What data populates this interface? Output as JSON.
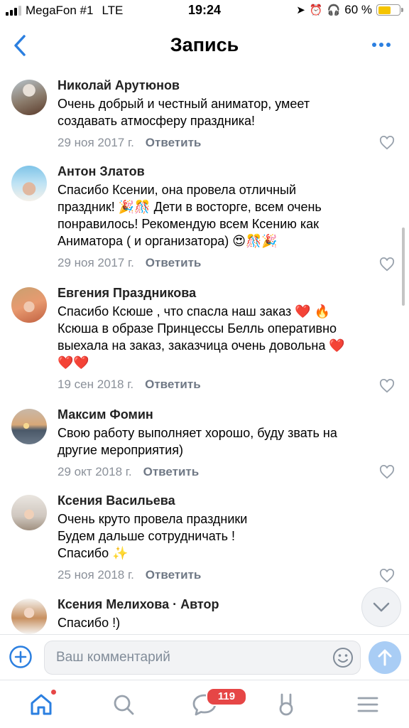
{
  "status_bar": {
    "carrier": "MegaFon #1",
    "network": "LTE",
    "time": "19:24",
    "battery": "60 %",
    "battery_level": 0.6,
    "battery_color": "#f5c400"
  },
  "header": {
    "title": "Запись",
    "back_icon": "chevron-left-icon",
    "more_icon": "more-dots-icon"
  },
  "comments": [
    {
      "author": "Николай Арутюнов",
      "text": "Очень добрый и честный аниматор, умеет\nсоздавать атмосферу праздника!",
      "date": "29 ноя 2017 г.",
      "reply": "Ответить"
    },
    {
      "author": "Антон Златов",
      "text": "Спасибо Ксении,  она провела отличный\nпраздник! 🎉🎊 Дети в восторге,  всем очень\nпонравилось!  Рекомендую всем Ксению как\nАниматора ( и организатора) 😍🎊🎉",
      "date": "29 ноя 2017 г.",
      "reply": "Ответить"
    },
    {
      "author": "Евгения Праздникова",
      "text": "Спасибо Ксюше , что спасла наш заказ ❤️ 🔥\nКсюша в образе Принцессы Белль оперативно\nвыехала на заказ, заказчица очень довольна ❤️\n❤️❤️",
      "date": "19 сен 2018 г.",
      "reply": "Ответить"
    },
    {
      "author": "Максим Фомин",
      "text": "Свою работу выполняет хорошо, буду звать на\nдругие мероприятия)",
      "date": "29 окт 2018 г.",
      "reply": "Ответить"
    },
    {
      "author": "Ксения Васильева",
      "text": "Очень круто провела праздники\nБудем дальше сотрудничать !\nСпасибо ✨",
      "date": "25 ноя 2018 г.",
      "reply": "Ответить"
    },
    {
      "author": "Ксения Мелихова · Автор",
      "text": "Спасибо !)",
      "date": "",
      "reply": ""
    }
  ],
  "composer": {
    "placeholder": "Ваш комментарий"
  },
  "tabbar": {
    "messages_badge": "119",
    "items": [
      "home-icon",
      "search-icon",
      "messages-icon",
      "services-icon",
      "menu-icon"
    ]
  },
  "colors": {
    "accent": "#2b7fe0",
    "badge": "#e64646",
    "send": "#a9cdf5"
  }
}
